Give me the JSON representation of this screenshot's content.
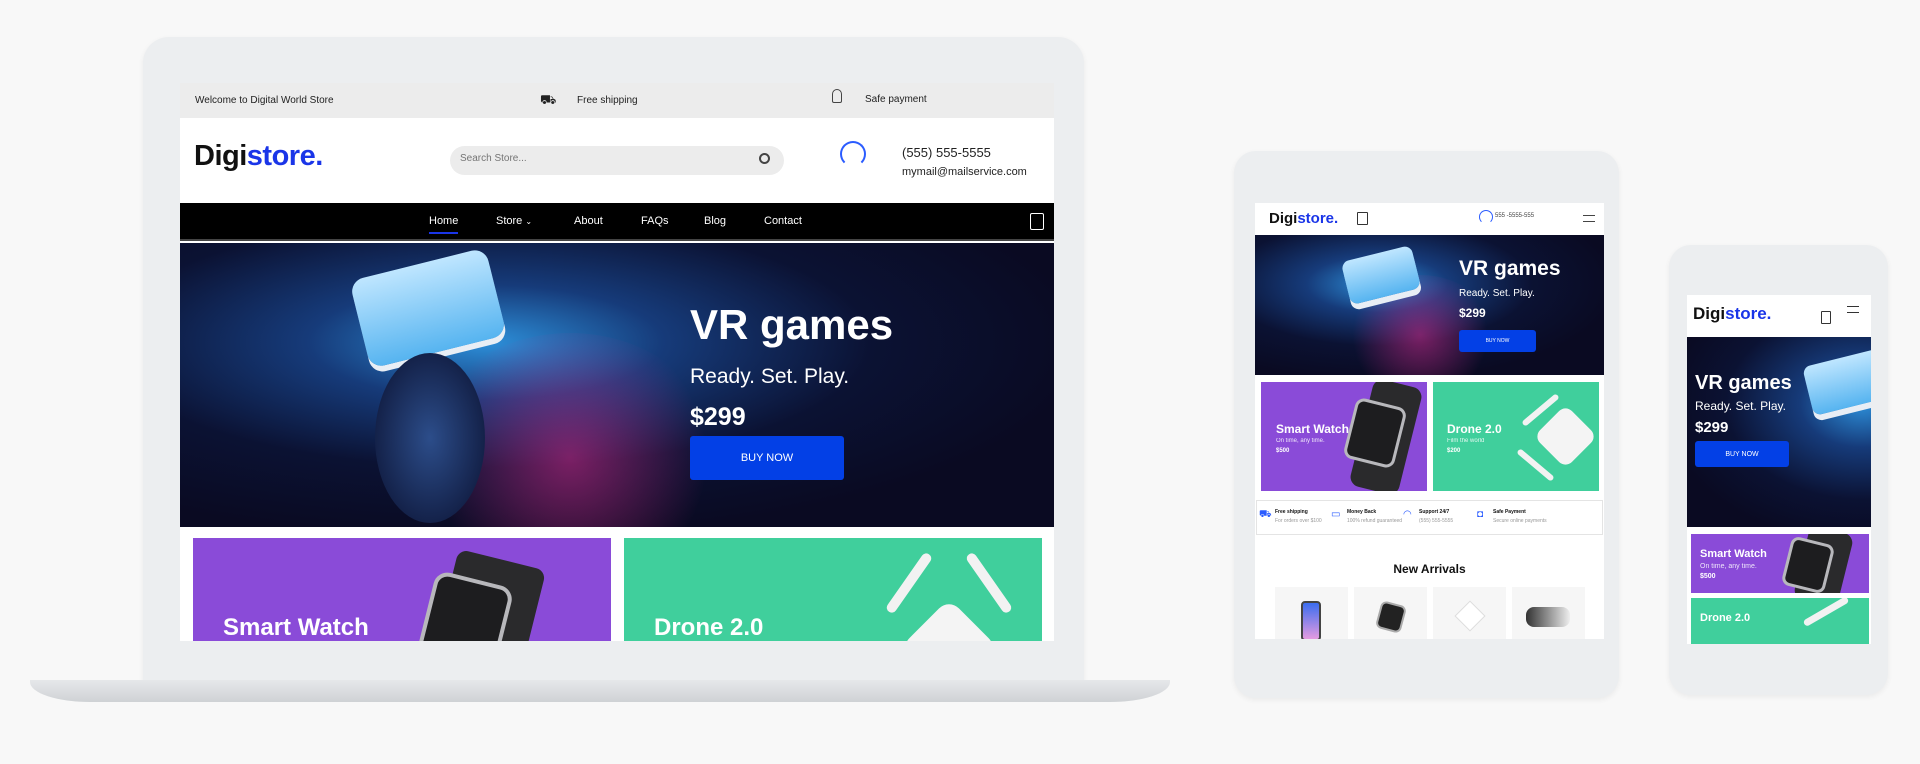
{
  "brand": {
    "logo_dark": "Digi",
    "logo_blue": "store.",
    "accent": "#1a35e8",
    "button_color": "#0340e6",
    "purple": "#8a4bd8",
    "green": "#40cf9c"
  },
  "desktop": {
    "topbar": {
      "welcome": "Welcome to Digital World Store",
      "shipping": "Free shipping",
      "payment": "Safe payment"
    },
    "header": {
      "search_placeholder": "Search Store...",
      "phone": "(555) 555-5555",
      "email": "mymail@mailservice.com"
    },
    "nav": [
      {
        "label": "Home",
        "active": true
      },
      {
        "label": "Store",
        "dropdown": true
      },
      {
        "label": "About"
      },
      {
        "label": "FAQs"
      },
      {
        "label": "Blog"
      },
      {
        "label": "Contact"
      }
    ],
    "hero": {
      "title": "VR games",
      "subtitle": "Ready. Set. Play.",
      "price": "$299",
      "button": "BUY NOW"
    },
    "cards": [
      {
        "title": "Smart Watch"
      },
      {
        "title": "Drone 2.0"
      }
    ]
  },
  "tablet": {
    "header": {
      "phone": "555 -5555-555"
    },
    "hero": {
      "title": "VR games",
      "subtitle": "Ready. Set. Play.",
      "price": "$299",
      "button": "BUY NOW"
    },
    "cards": [
      {
        "title": "Smart Watch",
        "subtitle": "On time, any time.",
        "price": "$500"
      },
      {
        "title": "Drone 2.0",
        "subtitle": "Film the world",
        "price": "$200"
      }
    ],
    "features": [
      {
        "icon": "truck-icon",
        "title": "Free shipping",
        "text": "For orders over $100"
      },
      {
        "icon": "money-icon",
        "title": "Money Back",
        "text": "100% refund guaranteed"
      },
      {
        "icon": "headset-icon",
        "title": "Support 24/7",
        "text": "(555) 555-5555"
      },
      {
        "icon": "lock-icon",
        "title": "Safe Payment",
        "text": "Secure online payments"
      }
    ],
    "new_arrivals": "New Arrivals"
  },
  "phone": {
    "hero": {
      "title": "VR games",
      "subtitle": "Ready. Set. Play.",
      "price": "$299",
      "button": "BUY NOW"
    },
    "cards": [
      {
        "title": "Smart Watch",
        "subtitle": "On time, any time.",
        "price": "$500"
      },
      {
        "title": "Drone 2.0"
      }
    ]
  }
}
